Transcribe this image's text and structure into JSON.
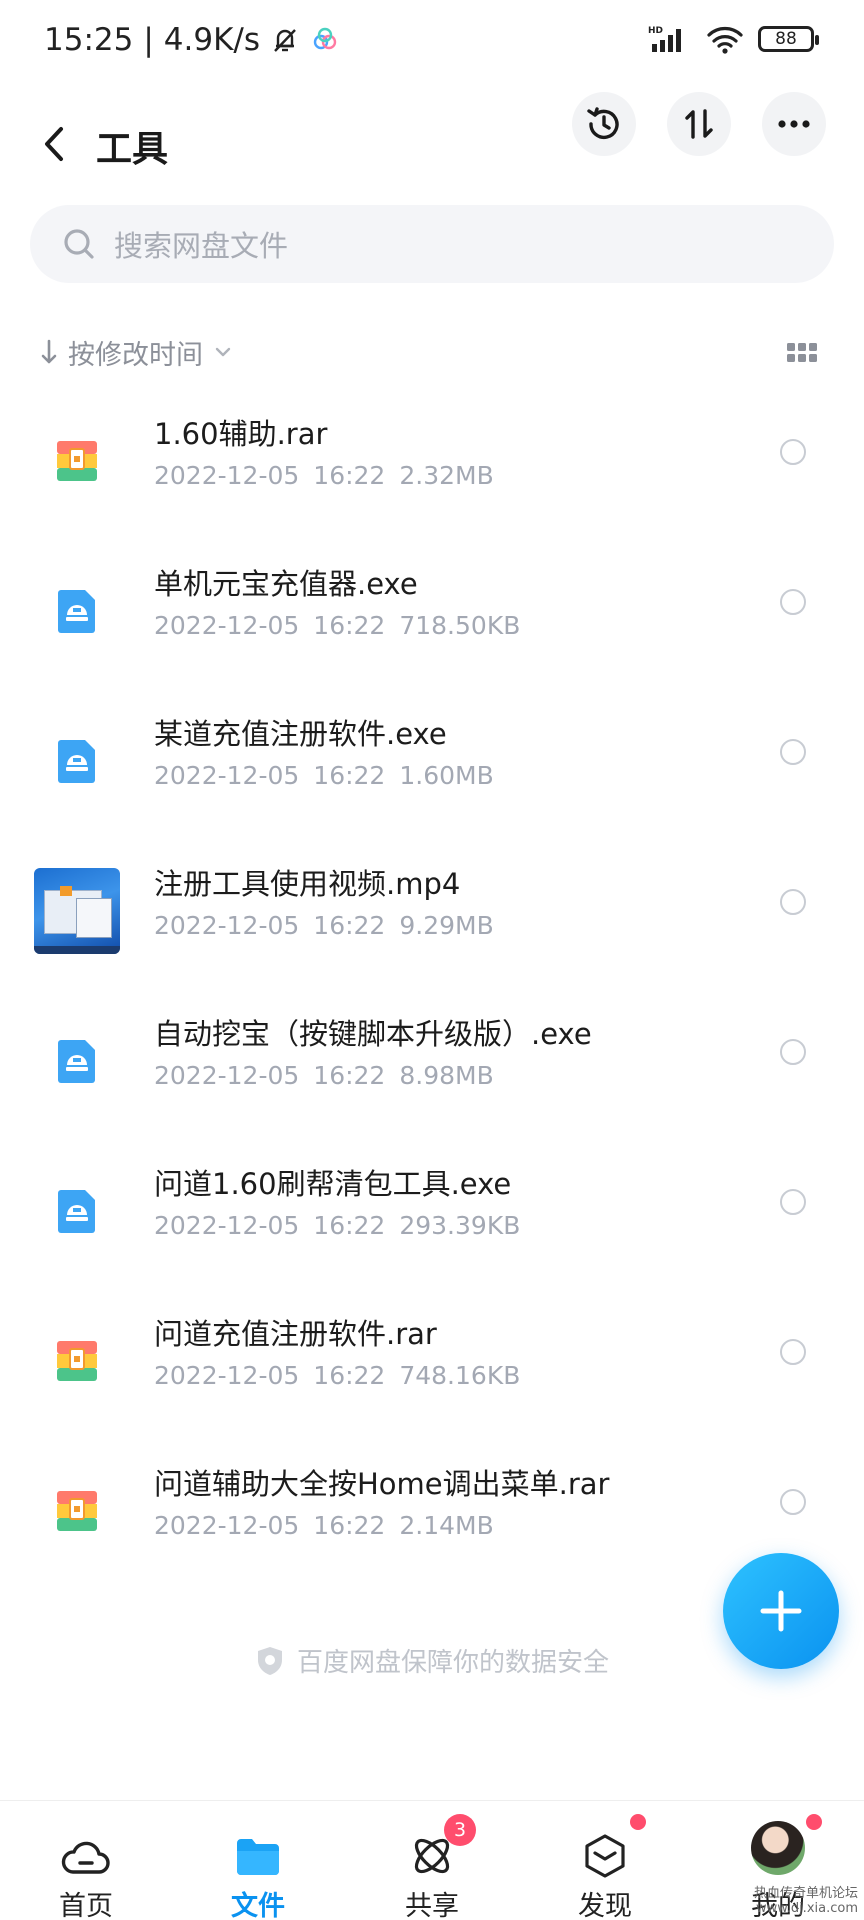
{
  "status_bar": {
    "time": "15:25",
    "net_speed": "4.9K/s",
    "battery": "88",
    "network": "HD"
  },
  "header": {
    "title": "工具"
  },
  "search": {
    "placeholder": "搜索网盘文件"
  },
  "sort": {
    "label": "按修改时间"
  },
  "files": [
    {
      "name": "1.60辅助.rar",
      "date": "2022-12-05",
      "time": "16:22",
      "size": "2.32MB",
      "icon": "rar-archive-icon"
    },
    {
      "name": "单机元宝充值器.exe",
      "date": "2022-12-05",
      "time": "16:22",
      "size": "718.50KB",
      "icon": "exe-file-icon"
    },
    {
      "name": "某道充值注册软件.exe",
      "date": "2022-12-05",
      "time": "16:22",
      "size": "1.60MB",
      "icon": "exe-file-icon"
    },
    {
      "name": "注册工具使用视频.mp4",
      "date": "2022-12-05",
      "time": "16:22",
      "size": "9.29MB",
      "icon": "video-thumbnail"
    },
    {
      "name": "自动挖宝（按键脚本升级版）.exe",
      "date": "2022-12-05",
      "time": "16:22",
      "size": "8.98MB",
      "icon": "exe-file-icon"
    },
    {
      "name": "问道1.60刷帮清包工具.exe",
      "date": "2022-12-05",
      "time": "16:22",
      "size": "293.39KB",
      "icon": "exe-file-icon"
    },
    {
      "name": "问道充值注册软件.rar",
      "date": "2022-12-05",
      "time": "16:22",
      "size": "748.16KB",
      "icon": "rar-archive-icon"
    },
    {
      "name": "问道辅助大全按Home调出菜单.rar",
      "date": "2022-12-05",
      "time": "16:22",
      "size": "2.14MB",
      "icon": "rar-archive-icon"
    }
  ],
  "security_note": "百度网盘保障你的数据安全",
  "bottom_nav": {
    "home": "首页",
    "files": "文件",
    "share": "共享",
    "share_badge": "3",
    "discover": "发现",
    "me": "我的"
  },
  "watermark": "热血传奇单机论坛\nwww.dj.xia.com",
  "colors": {
    "accent": "#0A92F0",
    "badge": "#FF4D6D",
    "exe_icon": "#3DA5F4"
  }
}
